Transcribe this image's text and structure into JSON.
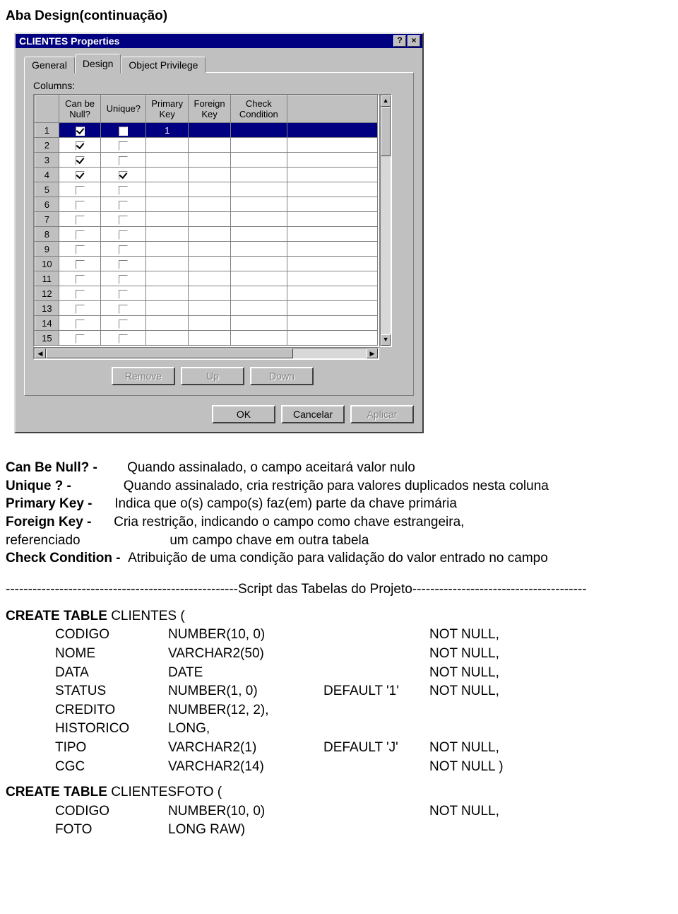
{
  "page_title": "Aba Design(continuação)",
  "dialog": {
    "title": "CLIENTES Properties",
    "help_btn": "?",
    "close_btn": "×",
    "tabs": [
      "General",
      "Design",
      "Object Privilege"
    ],
    "active_tab": 1,
    "columns_label": "Columns:",
    "headers": [
      "Can be Null?",
      "Unique?",
      "Primary Key",
      "Foreign Key",
      "Check Condition"
    ],
    "rows": [
      {
        "n": "1",
        "cbn": true,
        "unq": false,
        "pk": "1",
        "fk": "",
        "cc": "",
        "sel": true
      },
      {
        "n": "2",
        "cbn": true,
        "unq": false,
        "pk": "",
        "fk": "",
        "cc": "",
        "sel": false
      },
      {
        "n": "3",
        "cbn": true,
        "unq": false,
        "pk": "",
        "fk": "",
        "cc": "",
        "sel": false
      },
      {
        "n": "4",
        "cbn": true,
        "unq": true,
        "pk": "",
        "fk": "",
        "cc": "",
        "sel": false
      },
      {
        "n": "5",
        "cbn": false,
        "unq": false,
        "pk": "",
        "fk": "",
        "cc": "",
        "sel": false
      },
      {
        "n": "6",
        "cbn": false,
        "unq": false,
        "pk": "",
        "fk": "",
        "cc": "",
        "sel": false
      },
      {
        "n": "7",
        "cbn": false,
        "unq": false,
        "pk": "",
        "fk": "",
        "cc": "",
        "sel": false
      },
      {
        "n": "8",
        "cbn": false,
        "unq": false,
        "pk": "",
        "fk": "",
        "cc": "",
        "sel": false
      },
      {
        "n": "9",
        "cbn": false,
        "unq": false,
        "pk": "",
        "fk": "",
        "cc": "",
        "sel": false
      },
      {
        "n": "10",
        "cbn": false,
        "unq": false,
        "pk": "",
        "fk": "",
        "cc": "",
        "sel": false
      },
      {
        "n": "11",
        "cbn": false,
        "unq": false,
        "pk": "",
        "fk": "",
        "cc": "",
        "sel": false
      },
      {
        "n": "12",
        "cbn": false,
        "unq": false,
        "pk": "",
        "fk": "",
        "cc": "",
        "sel": false
      },
      {
        "n": "13",
        "cbn": false,
        "unq": false,
        "pk": "",
        "fk": "",
        "cc": "",
        "sel": false
      },
      {
        "n": "14",
        "cbn": false,
        "unq": false,
        "pk": "",
        "fk": "",
        "cc": "",
        "sel": false
      },
      {
        "n": "15",
        "cbn": false,
        "unq": false,
        "pk": "",
        "fk": "",
        "cc": "",
        "sel": false
      }
    ],
    "grid_buttons": {
      "remove": "Remove",
      "up": "Up",
      "down": "Down"
    },
    "dlg_buttons": {
      "ok": "OK",
      "cancel": "Cancelar",
      "apply": "Aplicar"
    }
  },
  "descriptions": {
    "l1a": "Can Be Null? -",
    "l1b": "Quando assinalado, o campo aceitará valor nulo",
    "l2a": "Unique ? -",
    "l2b": "Quando assinalado, cria restrição para valores duplicados nesta coluna",
    "l3a": "Primary Key -",
    "l3b": "Indica que o(s) campo(s) faz(em) parte da chave primária",
    "l4a": "Foreign Key -",
    "l4b": "Cria restrição, indicando o campo como chave estrangeira,",
    "l4c": "referenciado",
    "l4d": "um campo chave em outra tabela",
    "l5a": "Check Condition -",
    "l5b": "Atribuição de uma condição para validação do valor entrado no campo"
  },
  "separator": "----------------------------------------------------Script das Tabelas do Projeto---------------------------------------",
  "sql1": {
    "kw": "CREATE TABLE ",
    "name": "CLIENTES (",
    "rows": [
      {
        "n": "CODIGO",
        "t": "NUMBER(10, 0)",
        "d": "",
        "c": "NOT NULL,"
      },
      {
        "n": "NOME",
        "t": "VARCHAR2(50)",
        "d": "",
        "c": "NOT NULL,"
      },
      {
        "n": "DATA",
        "t": "DATE",
        "d": "",
        "c": "NOT NULL,"
      },
      {
        "n": "STATUS",
        "t": "NUMBER(1, 0)",
        "d": "DEFAULT '1'",
        "c": "NOT NULL,"
      },
      {
        "n": "CREDITO",
        "t": "NUMBER(12, 2),",
        "d": "",
        "c": ""
      },
      {
        "n": "HISTORICO",
        "t": "LONG,",
        "d": "",
        "c": ""
      },
      {
        "n": "TIPO",
        "t": "VARCHAR2(1)",
        "d": "DEFAULT 'J'",
        "c": "NOT NULL,"
      },
      {
        "n": "CGC",
        "t": "VARCHAR2(14)",
        "d": "",
        "c": "NOT NULL )"
      }
    ]
  },
  "sql2": {
    "kw": "CREATE TABLE ",
    "name": "CLIENTESFOTO (",
    "rows": [
      {
        "n": "CODIGO",
        "t": "NUMBER(10, 0)",
        "d": "",
        "c": "NOT NULL,"
      },
      {
        "n": "FOTO",
        "t": "LONG RAW)",
        "d": "",
        "c": ""
      }
    ]
  }
}
